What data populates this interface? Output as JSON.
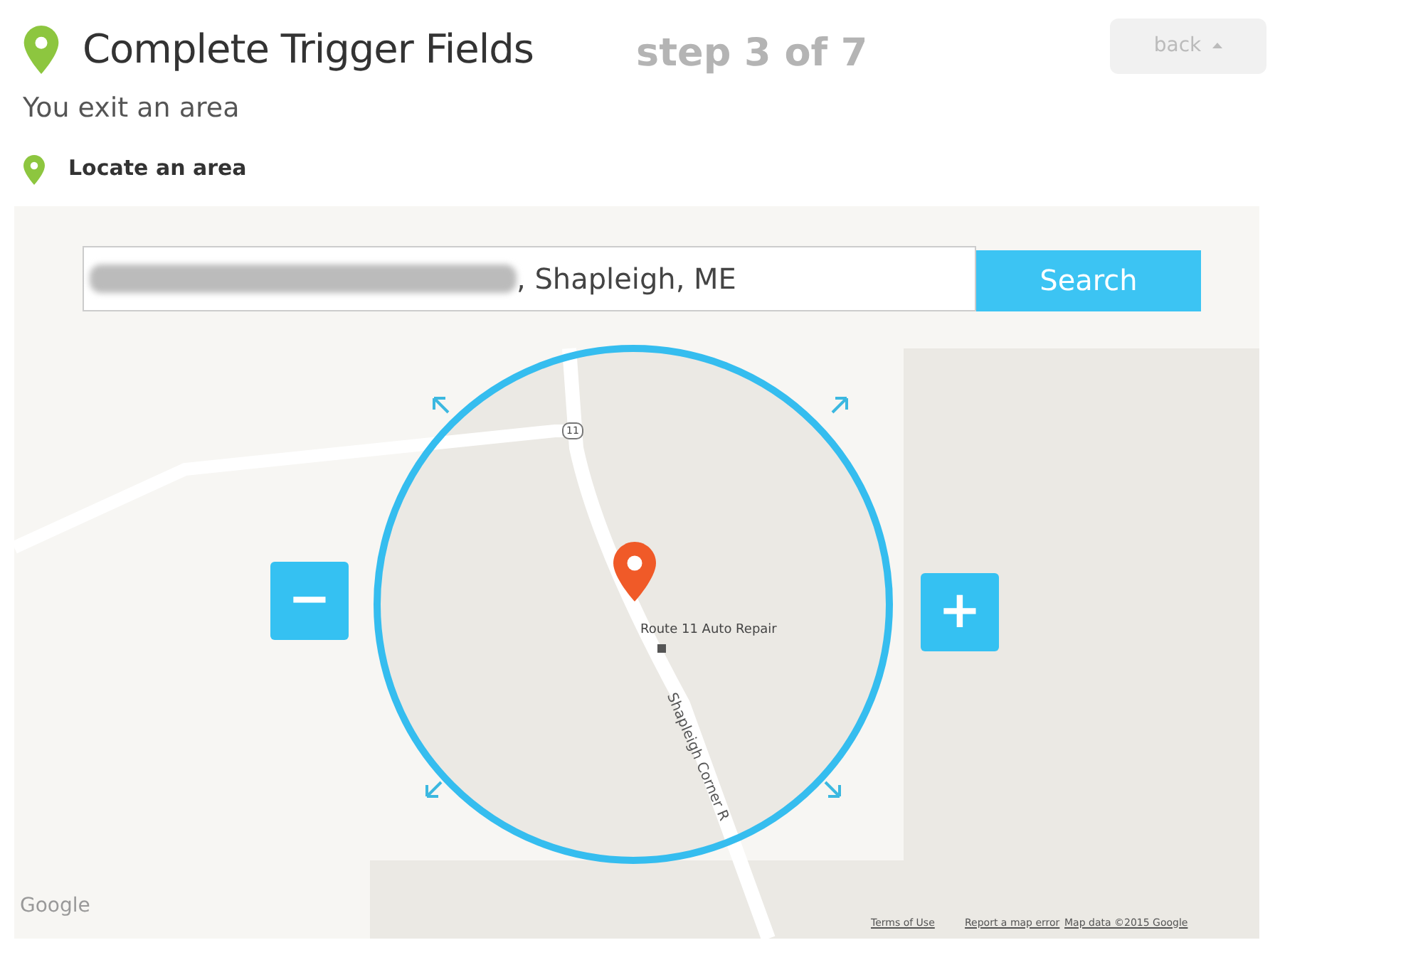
{
  "header": {
    "title": "Complete Trigger Fields",
    "step": "step 3 of 7",
    "back_button": "back"
  },
  "subtitle": "You exit an area",
  "section_label": "Locate an area",
  "map": {
    "search": {
      "value": ", Shapleigh, ME",
      "button": "Search"
    },
    "zoom_out": "−",
    "zoom_in": "+",
    "route_shield": "11",
    "place_label": "Route 11 Auto Repair",
    "road_label": "Shapleigh Corner R",
    "logo": "Google",
    "footer_links": [
      "Terms of Use",
      "Report a map error",
      "Map data ©2015 Google"
    ]
  }
}
